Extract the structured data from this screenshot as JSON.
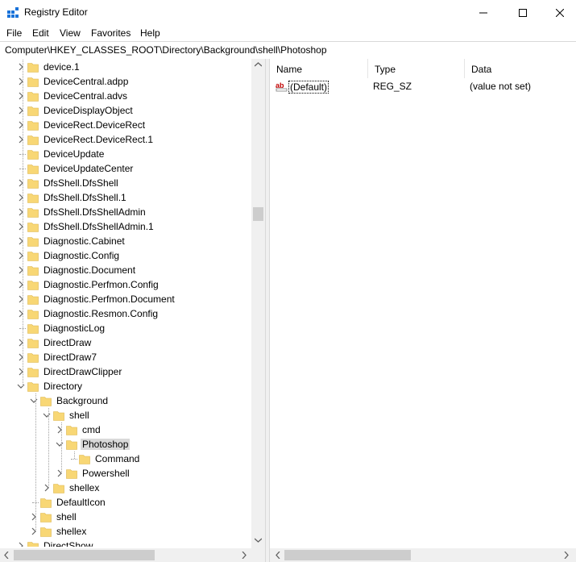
{
  "window": {
    "title": "Registry Editor",
    "controls": [
      "minimize",
      "maximize",
      "close"
    ]
  },
  "menu": [
    "File",
    "Edit",
    "View",
    "Favorites",
    "Help"
  ],
  "address": "Computer\\HKEY_CLASSES_ROOT\\Directory\\Background\\shell\\Photoshop",
  "tree": [
    {
      "label": "device.1",
      "depth": 0,
      "chevron": "right"
    },
    {
      "label": "DeviceCentral.adpp",
      "depth": 0,
      "chevron": "right"
    },
    {
      "label": "DeviceCentral.advs",
      "depth": 0,
      "chevron": "right"
    },
    {
      "label": "DeviceDisplayObject",
      "depth": 0,
      "chevron": "right"
    },
    {
      "label": "DeviceRect.DeviceRect",
      "depth": 0,
      "chevron": "right"
    },
    {
      "label": "DeviceRect.DeviceRect.1",
      "depth": 0,
      "chevron": "right"
    },
    {
      "label": "DeviceUpdate",
      "depth": 0,
      "chevron": "none"
    },
    {
      "label": "DeviceUpdateCenter",
      "depth": 0,
      "chevron": "none"
    },
    {
      "label": "DfsShell.DfsShell",
      "depth": 0,
      "chevron": "right"
    },
    {
      "label": "DfsShell.DfsShell.1",
      "depth": 0,
      "chevron": "right"
    },
    {
      "label": "DfsShell.DfsShellAdmin",
      "depth": 0,
      "chevron": "right"
    },
    {
      "label": "DfsShell.DfsShellAdmin.1",
      "depth": 0,
      "chevron": "right"
    },
    {
      "label": "Diagnostic.Cabinet",
      "depth": 0,
      "chevron": "right"
    },
    {
      "label": "Diagnostic.Config",
      "depth": 0,
      "chevron": "right"
    },
    {
      "label": "Diagnostic.Document",
      "depth": 0,
      "chevron": "right"
    },
    {
      "label": "Diagnostic.Perfmon.Config",
      "depth": 0,
      "chevron": "right"
    },
    {
      "label": "Diagnostic.Perfmon.Document",
      "depth": 0,
      "chevron": "right"
    },
    {
      "label": "Diagnostic.Resmon.Config",
      "depth": 0,
      "chevron": "right"
    },
    {
      "label": "DiagnosticLog",
      "depth": 0,
      "chevron": "none"
    },
    {
      "label": "DirectDraw",
      "depth": 0,
      "chevron": "right"
    },
    {
      "label": "DirectDraw7",
      "depth": 0,
      "chevron": "right"
    },
    {
      "label": "DirectDrawClipper",
      "depth": 0,
      "chevron": "right"
    },
    {
      "label": "Directory",
      "depth": 0,
      "chevron": "down"
    },
    {
      "label": "Background",
      "depth": 1,
      "chevron": "down"
    },
    {
      "label": "shell",
      "depth": 2,
      "chevron": "down"
    },
    {
      "label": "cmd",
      "depth": 3,
      "chevron": "right"
    },
    {
      "label": "Photoshop",
      "depth": 3,
      "chevron": "down",
      "selected": true
    },
    {
      "label": "Command",
      "depth": 4,
      "chevron": "none"
    },
    {
      "label": "Powershell",
      "depth": 3,
      "chevron": "right"
    },
    {
      "label": "shellex",
      "depth": 2,
      "chevron": "right"
    },
    {
      "label": "DefaultIcon",
      "depth": 1,
      "chevron": "none"
    },
    {
      "label": "shell",
      "depth": 1,
      "chevron": "right"
    },
    {
      "label": "shellex",
      "depth": 1,
      "chevron": "right"
    },
    {
      "label": "DirectShow",
      "depth": 0,
      "chevron": "right"
    }
  ],
  "list": {
    "columns": [
      "Name",
      "Type",
      "Data"
    ],
    "rows": [
      {
        "name": "(Default)",
        "type": "REG_SZ",
        "data": "(value not set)",
        "icon": "string-value-icon"
      }
    ]
  },
  "scroll": {
    "tree_vertical_position": 0.3
  },
  "colors": {
    "folder": "#f8d775",
    "selection": "#d9d9d9",
    "scrollbar_thumb": "#cdcdcd"
  }
}
